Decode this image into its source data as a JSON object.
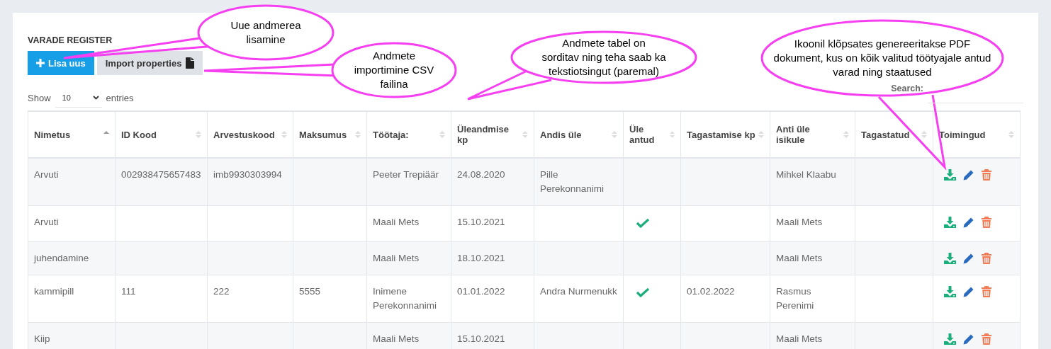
{
  "title": "VARADE REGISTER",
  "buttons": {
    "add": "Lisa uus",
    "import": "Import properties"
  },
  "length": {
    "label_before": "Show",
    "value": "10",
    "label_after": "entries"
  },
  "search": {
    "label": "Search:"
  },
  "table": {
    "columns": [
      {
        "label": "Nimetus",
        "sorted": true
      },
      {
        "label": "ID Kood",
        "sorted": false
      },
      {
        "label": "Arvestuskood",
        "sorted": false
      },
      {
        "label": "Maksumus",
        "sorted": false
      },
      {
        "label": "Töötaja:",
        "sorted": false
      },
      {
        "label": "Üleandmise kp",
        "sorted": false
      },
      {
        "label": "Andis üle",
        "sorted": false
      },
      {
        "label": "Üle antud",
        "sorted": false
      },
      {
        "label": "Tagastamise kp",
        "sorted": false
      },
      {
        "label": "Anti üle isikule",
        "sorted": false
      },
      {
        "label": "Tagastatud",
        "sorted": false
      },
      {
        "label": "Toimingud",
        "sorted": false
      }
    ],
    "rows": [
      {
        "name": "Arvuti",
        "id_code": "002938475657483",
        "account_code": "imb9930303994",
        "employee": "Peeter Trepiäär",
        "handover_date": "24.08.2020",
        "handed_by": "Pille Perekonnanimi",
        "handed_over": false,
        "given_to": "Mihkel Klaabu"
      },
      {
        "name": "Arvuti",
        "employee": "Maali Mets",
        "handover_date": "15.10.2021",
        "handed_over": true,
        "given_to": "Maali Mets"
      },
      {
        "name": "juhendamine",
        "employee": "Maali Mets",
        "handover_date": "18.10.2021",
        "handed_over": false,
        "given_to": "Maali Mets"
      },
      {
        "name": "kammipill",
        "id_code": "111",
        "account_code": "222",
        "cost": "5555",
        "employee": "Inimene Perekonnanimi",
        "handover_date": "01.01.2022",
        "handed_by": "Andra Nurmenukk",
        "handed_over": true,
        "return_date": "01.02.2022",
        "given_to": "Rasmus Perenimi"
      },
      {
        "name": "Kiip",
        "employee": "Maali Mets",
        "handover_date": "15.10.2021",
        "handed_over": false,
        "given_to": "Maali Mets"
      }
    ]
  },
  "callouts": [
    {
      "text": "Uue andmerea\nlisamine"
    },
    {
      "text": "Andmete\nimportimine CSV\nfailina"
    },
    {
      "text": "Andmete tabel on\nsorditav ning teha saab ka\ntekstiotsingut (paremal)"
    },
    {
      "text": "Ikoonil klõpsates genereeritakse PDF\ndokument, kus on kõik valitud töötyajale antud\nvarad ning staatused"
    }
  ]
}
